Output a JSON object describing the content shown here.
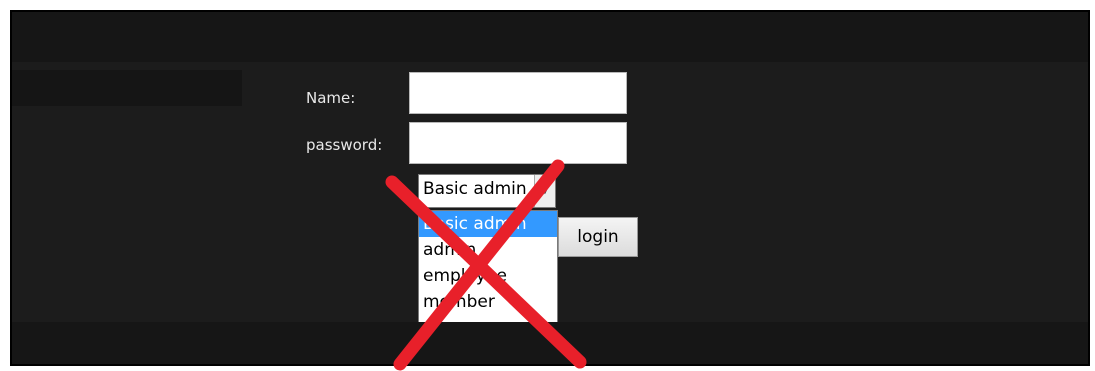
{
  "form": {
    "name_label": "Name:",
    "name_value": "",
    "password_label": "password:",
    "password_value": "",
    "role_select": {
      "selected": "Basic admin",
      "options": [
        "Basic admin",
        "admin",
        "employee",
        "member"
      ],
      "highlighted": "Basic admin"
    },
    "login_label": "login"
  },
  "overlay": {
    "icon": "cross-out-icon",
    "color": "#e8202a"
  },
  "colors": {
    "background": "#1c1c1c",
    "selection": "#3399ff"
  }
}
